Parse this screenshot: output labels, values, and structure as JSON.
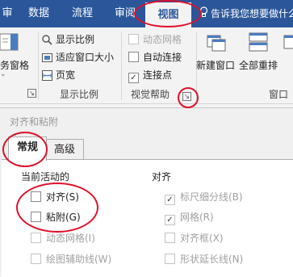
{
  "ribbon_tabs": {
    "t0": "审",
    "t1": "数据",
    "t2": "流程",
    "t3": "审阅",
    "t4": "视图"
  },
  "tell_me": "告诉我您想要做什么",
  "ribbon": {
    "pane": "务窗格",
    "show_ratio": "显示比例",
    "fit_window": "适应窗口大小",
    "page_width": "页宽",
    "zoom_group": "显示比例",
    "dynamic_grid": "动态网格",
    "auto_connect": "自动连接",
    "connection_points": "连接点",
    "visual_aids_group": "视觉帮助",
    "new_window": "新建窗口",
    "arrange_all": "全部重排",
    "window_group": "窗口",
    "connection_points_checked": "✓"
  },
  "dialog": {
    "title": "对齐和粘附",
    "tab_general": "常规",
    "tab_advanced": "高级",
    "currently_active": "当前活动的",
    "align_section": "对齐",
    "options_left": [
      {
        "label": "对齐(S)"
      },
      {
        "label": "粘附(G)"
      },
      {
        "label": "动态网格(I)"
      },
      {
        "label": "绘图辅助线(W)"
      }
    ],
    "options_right": [
      {
        "label": "标尺细分线(B)",
        "check": "✓"
      },
      {
        "label": "网格(R)",
        "check": "✓"
      },
      {
        "label": "对齐框(X)"
      },
      {
        "label": "形状延长线(N)"
      }
    ]
  },
  "colors": {
    "ribbon_blue": "#2b579a",
    "annotation_red": "#e0102a"
  }
}
